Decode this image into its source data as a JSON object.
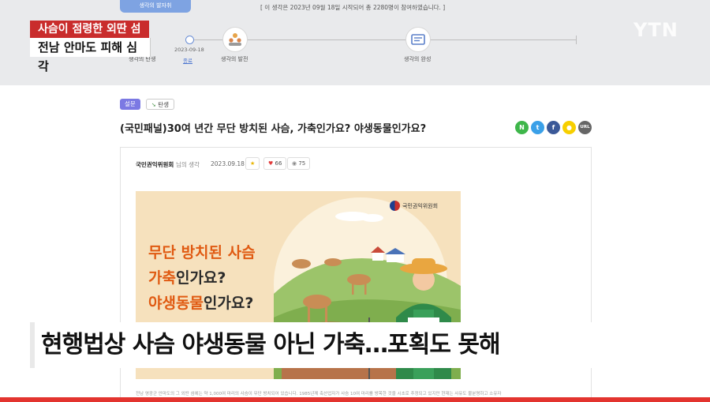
{
  "header": {
    "tab_label": "생각의 발자취",
    "notice": "[ 이 생각은 2023년 09월 18일 시작되어 총 2280명이 참여하였습니다. ]",
    "timeline": {
      "date": "2023-09-18",
      "done_label": "종료",
      "stages": [
        "생각의 탄생",
        "생각의 발전",
        "생각의 완성"
      ]
    },
    "logo": "YTN"
  },
  "broadcast": {
    "label_top": "사슴이 점령한 외딴 섬",
    "label_bottom": "전남 안마도 피해 심각",
    "caption": "현행법상 사슴 야생동물 아닌 가축…포획도 못해",
    "progress": 1.0
  },
  "article": {
    "category": "설문",
    "status_tag": "탄생",
    "title": "(국민패널)30여 년간 무단 방치된 사슴, 가축인가요? 야생동물인가요?",
    "share": [
      {
        "label": "N",
        "color": "#3eb64a"
      },
      {
        "label": "t",
        "color": "#3aa0e8"
      },
      {
        "label": "f",
        "color": "#3b5998"
      },
      {
        "label": "●",
        "color": "#f7cf00"
      },
      {
        "label": "URL",
        "color": "#666666"
      }
    ],
    "author": "국민권익위원회",
    "author_suffix": "님의 생각",
    "date": "2023.09.18",
    "likes": "66",
    "comments": "75",
    "banner": {
      "org": "국민권익위원회",
      "line1": "무단 방치된 사슴",
      "line2_highlight": "가축",
      "line2_rest": "인가요?",
      "line3_highlight": "야생동물",
      "line3_rest": "인가요?"
    },
    "body_preview": "전남 영광군 안마도의 그 외딴 섬에는 약 1,000여 마리의 사슴이 무단 방치되어 있습니다. 1985년께 축산업자가 사슴 10여 마리를 방목한 것을 시초로 추정되고 있지만 현재는 사유도 불분명하고 소유자"
  }
}
